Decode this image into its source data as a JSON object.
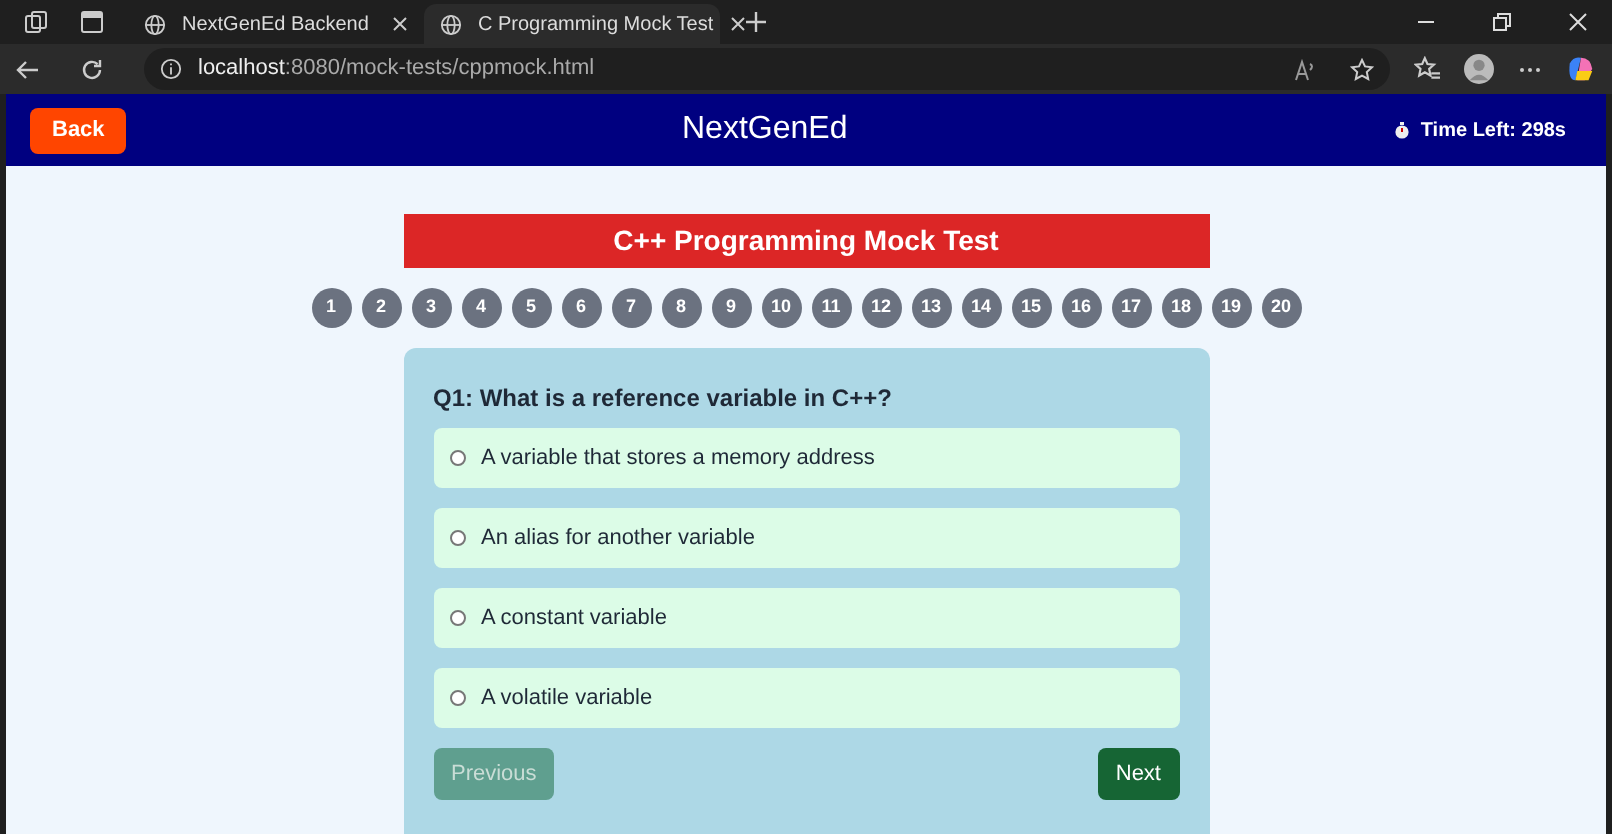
{
  "browser": {
    "tabs": [
      {
        "title": "NextGenEd Backend",
        "selected": false
      },
      {
        "title": "C Programming Mock Test",
        "selected": true
      }
    ],
    "address": {
      "host": "localhost",
      "rest": ":8080/mock-tests/cppmock.html"
    }
  },
  "header": {
    "back": "Back",
    "brand": "NextGenEd",
    "timer": "Time Left: 298s"
  },
  "test": {
    "title": "C++ Programming Mock Test",
    "question_numbers": [
      {
        "label": "1"
      },
      {
        "label": "2"
      },
      {
        "label": "3"
      },
      {
        "label": "4"
      },
      {
        "label": "5"
      },
      {
        "label": "6"
      },
      {
        "label": "7"
      },
      {
        "label": "8"
      },
      {
        "label": "9"
      },
      {
        "label": "10"
      },
      {
        "label": "11"
      },
      {
        "label": "12"
      },
      {
        "label": "13"
      },
      {
        "label": "14"
      },
      {
        "label": "15"
      },
      {
        "label": "16"
      },
      {
        "label": "17"
      },
      {
        "label": "18"
      },
      {
        "label": "19"
      },
      {
        "label": "20"
      }
    ],
    "question": "Q1: What is a reference variable in C++?",
    "options": [
      {
        "text": "A variable that stores a memory address",
        "checked": false
      },
      {
        "text": "An alias for another variable",
        "checked": false
      },
      {
        "text": "A constant variable",
        "checked": false
      },
      {
        "text": "A volatile variable",
        "checked": false
      }
    ],
    "buttons": [
      {
        "label": "Previous",
        "kind": "previous",
        "disabled": true
      },
      {
        "label": "Next",
        "kind": "next",
        "disabled": false
      }
    ]
  }
}
